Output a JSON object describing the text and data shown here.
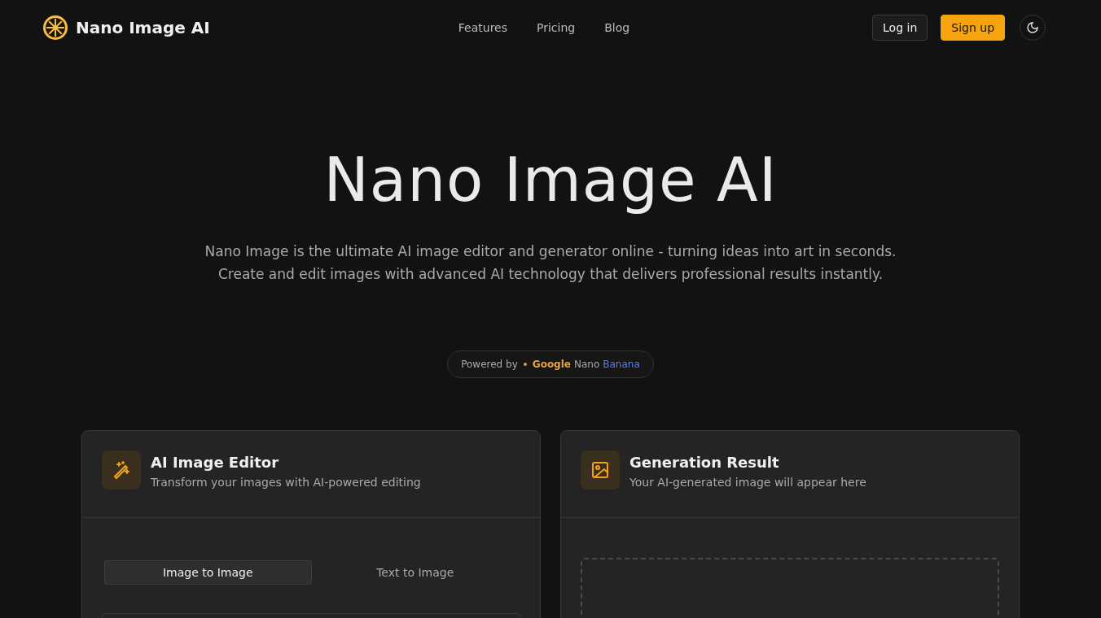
{
  "header": {
    "brand": "Nano Image AI",
    "nav": [
      "Features",
      "Pricing",
      "Blog"
    ],
    "login": "Log in",
    "signup": "Sign up"
  },
  "hero": {
    "title": "Nano Image AI",
    "subtitle": [
      "Nano Image is the ultimate AI image editor and generator online - turning ideas into art in seconds.",
      "Create and edit images with advanced AI technology that delivers professional results instantly."
    ],
    "powered": {
      "label": "Powered by",
      "brand": [
        {
          "text": "Google",
          "color": "#e8a33a"
        },
        {
          "text": "Nano",
          "color": "#a8a8a8"
        },
        {
          "text": "Banana",
          "color": "#5b7fe0"
        }
      ]
    }
  },
  "editor": {
    "title": "AI Image Editor",
    "subtitle": "Transform your images with AI-powered editing",
    "tabs": [
      {
        "label": "Image to Image",
        "selected": true
      },
      {
        "label": "Text to Image",
        "selected": false
      }
    ]
  },
  "result": {
    "title": "Generation Result",
    "subtitle": "Your AI-generated image will appear here"
  }
}
